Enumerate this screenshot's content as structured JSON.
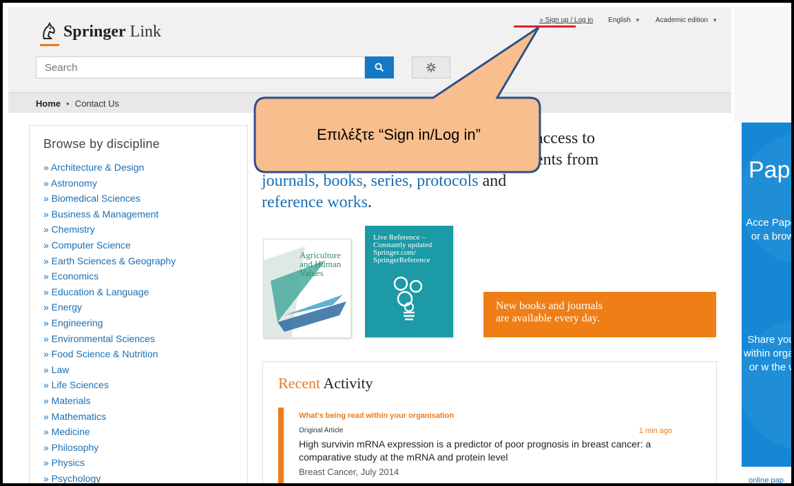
{
  "header": {
    "logo_bold": "Springer",
    "logo_light": " Link",
    "search_placeholder": "Search",
    "topnav": {
      "signup": "» Sign up / Log in",
      "language": "English",
      "edition": "Academic edition"
    }
  },
  "breadcrumb": {
    "home": "Home",
    "contact": "Contact Us"
  },
  "sidebar": {
    "title": "Browse by discipline",
    "items": [
      "» Architecture & Design",
      "» Astronomy",
      "» Biomedical Sciences",
      "» Business & Management",
      "» Chemistry",
      "» Computer Science",
      "» Earth Sciences & Geography",
      "» Economics",
      "» Education & Language",
      "» Energy",
      "» Engineering",
      "» Environmental Sciences",
      "» Food Science & Nutrition",
      "» Law",
      "» Life Sciences",
      "» Materials",
      "» Mathematics",
      "» Medicine",
      "» Philosophy",
      "» Physics",
      "» Psychology"
    ]
  },
  "intro": {
    "line1": "access to",
    "line2": "ents from",
    "line3_blue": "journals, books, series, protocols",
    "line3_end": " and",
    "line4_blue": "reference works",
    "line4_end": "."
  },
  "books": {
    "book1_title": "Agriculture and Human Values",
    "book2_title": "Live Reference – Constantly updated Springer.com/ SpringerReference"
  },
  "banner": {
    "line1": "New books and journals",
    "line2": "are available every day."
  },
  "recent": {
    "title_orange": "Recent",
    "title_rest": " Activity",
    "subheading": "What's being read within your organisation",
    "article_type": "Original Article",
    "time": "1 min ago",
    "article_title": "High survivin mRNA expression is a predictor of poor prognosis in breast cancer: a comparative study at the mRNA and protein level",
    "source": "Breast Cancer, July 2014"
  },
  "ad": {
    "title": "Pap",
    "text1": "Acce Paper or a brow",
    "text2": "Share your within organi or w the w",
    "footer": "online.pap"
  },
  "callout": {
    "text": "Επιλέξτε “Sign in/Log in”"
  },
  "colors": {
    "accent_blue": "#1578c6",
    "link_blue": "#1a6fb4",
    "orange": "#ef7e16",
    "callout_fill": "#f9be8d",
    "callout_stroke": "#2f4f86"
  }
}
